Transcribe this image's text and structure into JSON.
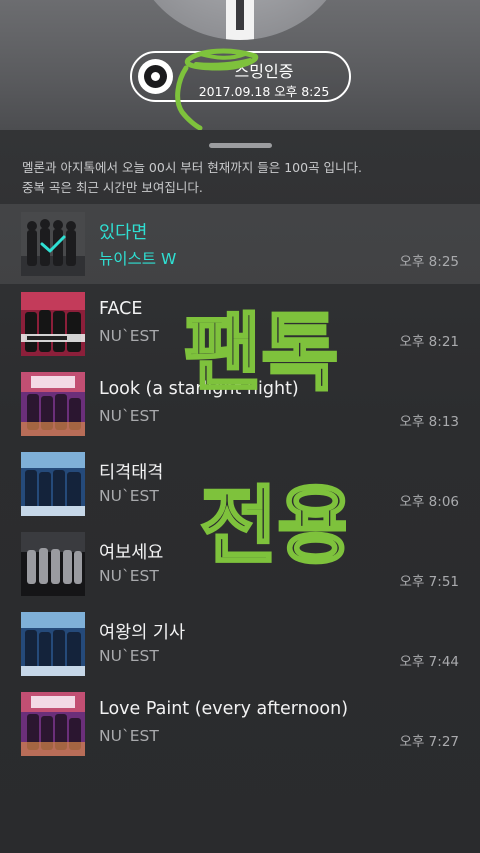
{
  "header": {
    "badge_title": "스밍인증",
    "badge_date": "2017.09.18 오후 8:25"
  },
  "notice": {
    "line1": "멜론과 아지톡에서 오늘 00시 부터 현재까지 들은 100곡 입니다.",
    "line2": "중복 곡은 최근 시간만 보여집니다."
  },
  "tracks": [
    {
      "title": "있다면",
      "artist": "뉴이스트 W",
      "time": "오후 8:25",
      "current": true,
      "cover": "nuest-w"
    },
    {
      "title": "FACE",
      "artist": "NU`EST",
      "time": "오후 8:21",
      "current": false,
      "cover": "face"
    },
    {
      "title": "Look (a starlight night)",
      "artist": "NU`EST",
      "time": "오후 8:13",
      "current": false,
      "cover": "canvas"
    },
    {
      "title": "티격태격",
      "artist": "NU`EST",
      "time": "오후 8:06",
      "current": false,
      "cover": "blue"
    },
    {
      "title": "여보세요",
      "artist": "NU`EST",
      "time": "오후 7:51",
      "current": false,
      "cover": "dark"
    },
    {
      "title": "여왕의 기사",
      "artist": "NU`EST",
      "time": "오후 7:44",
      "current": false,
      "cover": "blue"
    },
    {
      "title": "Love Paint (every afternoon)",
      "artist": "NU`EST",
      "time": "오후 7:27",
      "current": false,
      "cover": "canvas"
    }
  ],
  "handwriting": {
    "line1": "팬톡",
    "line2": "전용"
  },
  "colors": {
    "accent": "#2fe0d3",
    "handwriting": "#7ec23c"
  }
}
